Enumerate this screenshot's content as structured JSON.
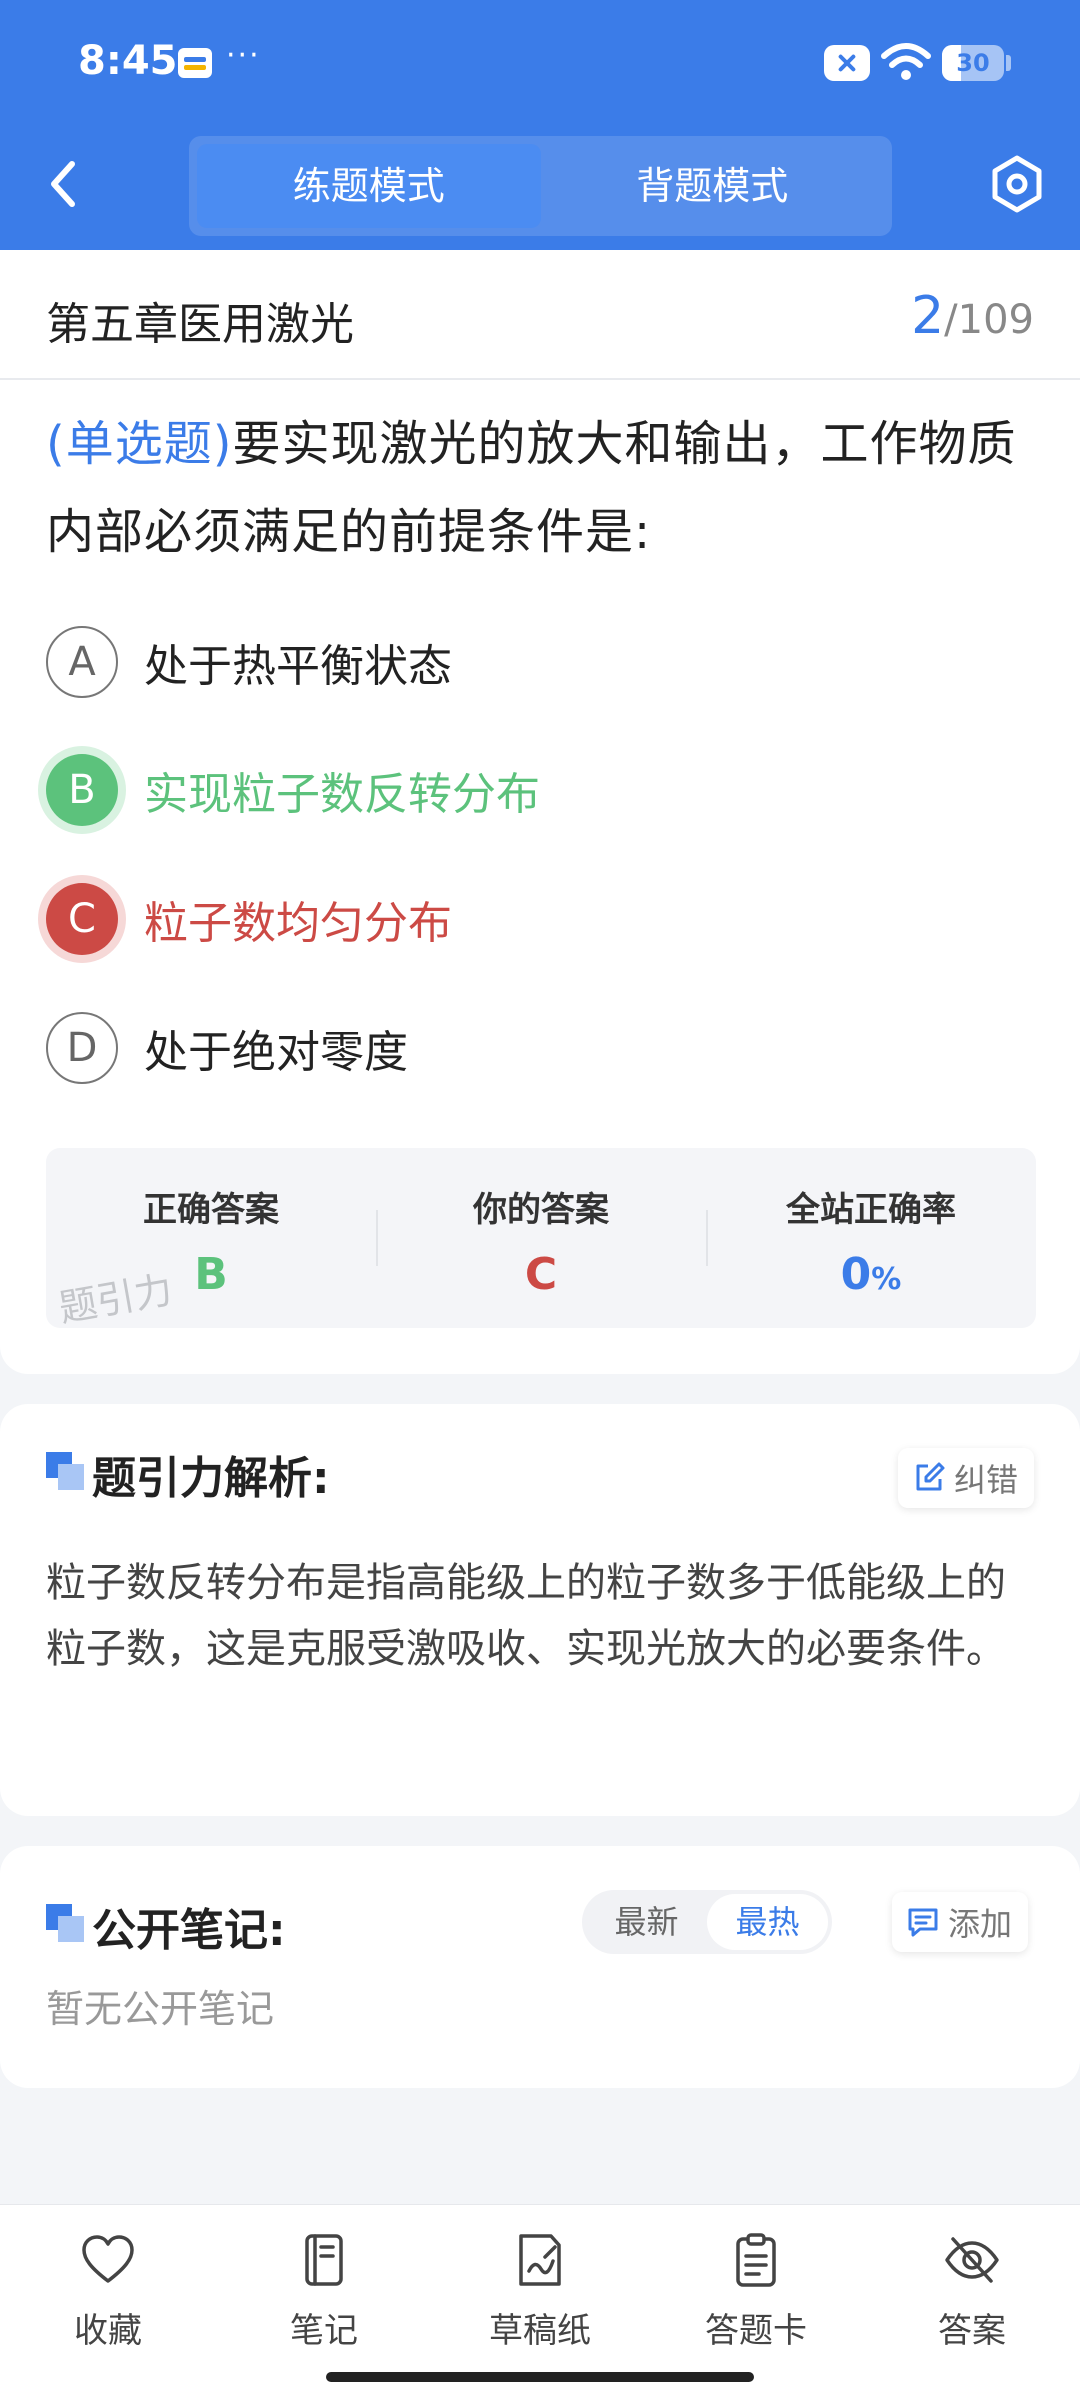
{
  "status_bar": {
    "time": "8:45",
    "dots": "···",
    "battery": "30",
    "battery_level_percent": 30
  },
  "header": {
    "tabs": [
      {
        "label": "练题模式",
        "active": true
      },
      {
        "label": "背题模式",
        "active": false
      }
    ],
    "icons": {
      "back": "back-arrow-icon",
      "settings": "hexagon-settings-icon"
    }
  },
  "chapter": {
    "title": "第五章医用激光",
    "current": "2",
    "total": "/109"
  },
  "question": {
    "type": "(单选题)",
    "text": "要实现激光的放大和输出，工作物质内部必须满足的前提条件是:",
    "options": [
      {
        "letter": "A",
        "text": "处于热平衡状态",
        "state": "normal"
      },
      {
        "letter": "B",
        "text": "实现粒子数反转分布",
        "state": "correct"
      },
      {
        "letter": "C",
        "text": "粒子数均匀分布",
        "state": "wrong"
      },
      {
        "letter": "D",
        "text": "处于绝对零度",
        "state": "normal"
      }
    ]
  },
  "answer": {
    "correct_label": "正确答案",
    "correct_value": "B",
    "yours_label": "你的答案",
    "yours_value": "C",
    "rate_label": "全站正确率",
    "rate_value": "0",
    "rate_unit": "%",
    "watermark": "题引力"
  },
  "analysis": {
    "title": "题引力解析:",
    "report_label": "纠错",
    "text": "粒子数反转分布是指高能级上的粒子数多于低能级上的粒子数，这是克服受激吸收、实现光放大的必要条件。"
  },
  "notes": {
    "title": "公开笔记:",
    "sort_options": [
      {
        "label": "最新",
        "active": false
      },
      {
        "label": "最热",
        "active": true
      }
    ],
    "add_label": "添加",
    "empty_text": "暂无公开笔记"
  },
  "bottom_bar": [
    {
      "label": "收藏",
      "icon": "heart-icon"
    },
    {
      "label": "笔记",
      "icon": "notebook-icon"
    },
    {
      "label": "草稿纸",
      "icon": "scratch-paper-icon"
    },
    {
      "label": "答题卡",
      "icon": "answer-sheet-icon"
    },
    {
      "label": "答案",
      "icon": "eye-off-icon"
    }
  ],
  "colors": {
    "primary": "#3b7ce8",
    "correct": "#5cc27c",
    "wrong": "#cc4a45",
    "background": "#f3f5f8"
  }
}
